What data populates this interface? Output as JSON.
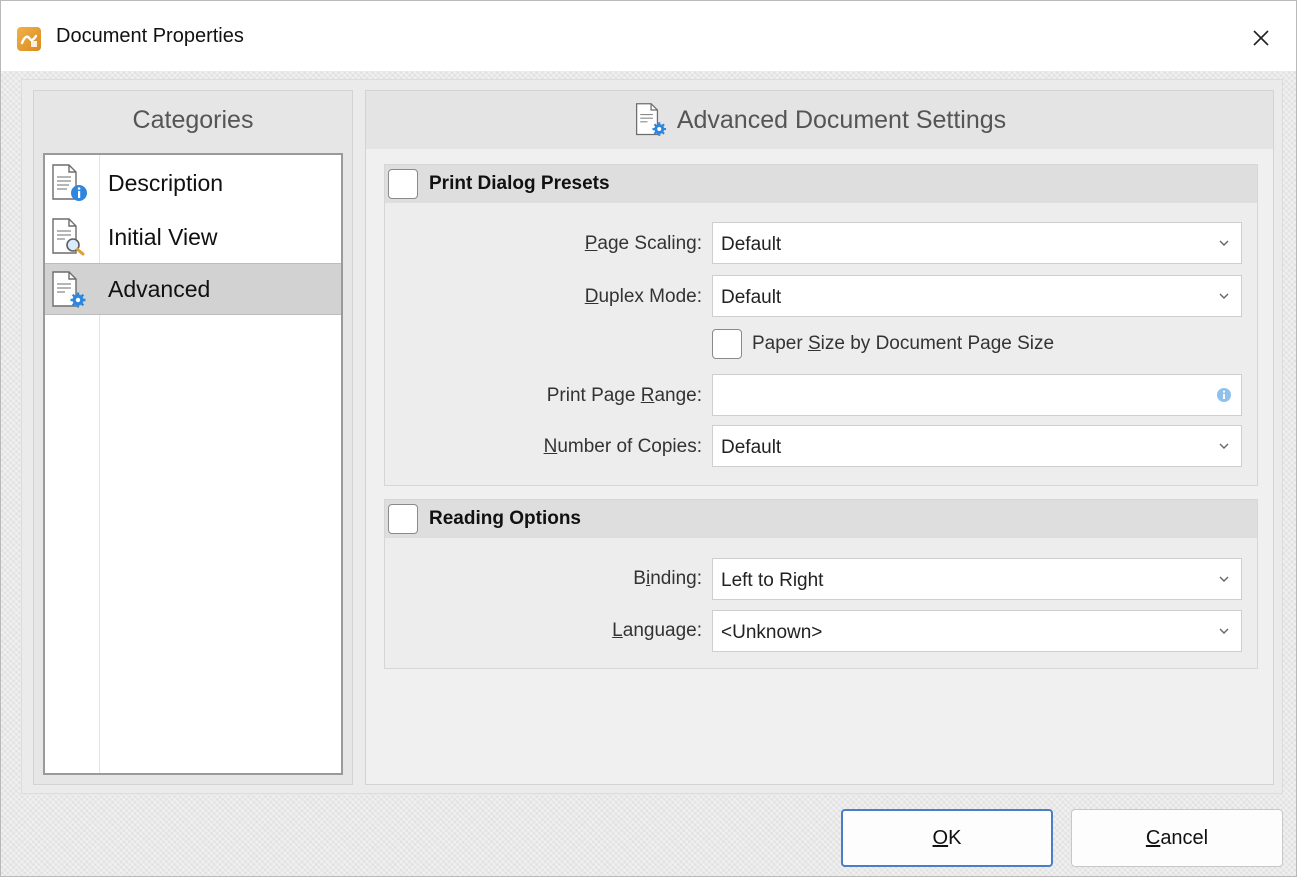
{
  "window": {
    "title": "Document Properties",
    "app_icon": "app-logo-icon",
    "close_icon": "close-icon"
  },
  "categories": {
    "header": "Categories",
    "items": [
      {
        "label": "Description",
        "icon": "document-info-icon",
        "selected": false
      },
      {
        "label": "Initial View",
        "icon": "document-search-icon",
        "selected": false
      },
      {
        "label": "Advanced",
        "icon": "document-gear-icon",
        "selected": true
      }
    ]
  },
  "advanced": {
    "header": "Advanced Document Settings",
    "header_icon": "document-gear-icon",
    "print_group": {
      "title": "Print Dialog Presets",
      "checked": false,
      "page_scaling": {
        "label_pre": "",
        "label_u": "P",
        "label_post": "age Scaling:",
        "value": "Default"
      },
      "duplex_mode": {
        "label_pre": "",
        "label_u": "D",
        "label_post": "uplex Mode:",
        "value": "Default"
      },
      "paper_size": {
        "label_pre": "Paper ",
        "label_u": "S",
        "label_post": "ize by Document Page Size",
        "checked": false
      },
      "print_page_range": {
        "label_pre": "Print Page ",
        "label_u": "R",
        "label_post": "ange:",
        "value": "",
        "info_icon": "info-icon"
      },
      "number_of_copies": {
        "label_pre": "",
        "label_u": "N",
        "label_post": "umber of Copies:",
        "value": "Default"
      }
    },
    "reading_group": {
      "title": "Reading Options",
      "checked": false,
      "binding": {
        "label_pre": "B",
        "label_u": "i",
        "label_post": "nding:",
        "value": "Left to Right"
      },
      "language": {
        "label_pre": "",
        "label_u": "L",
        "label_post": "anguage:",
        "value": "<Unknown>"
      }
    }
  },
  "buttons": {
    "ok": {
      "label_u": "O",
      "label_post": "K"
    },
    "cancel": {
      "label_u": "C",
      "label_post": "ancel"
    }
  },
  "colors": {
    "accent": "#4a7fc6",
    "icon_blue": "#2e86de",
    "app_icon_orange": "#e09a2a"
  }
}
